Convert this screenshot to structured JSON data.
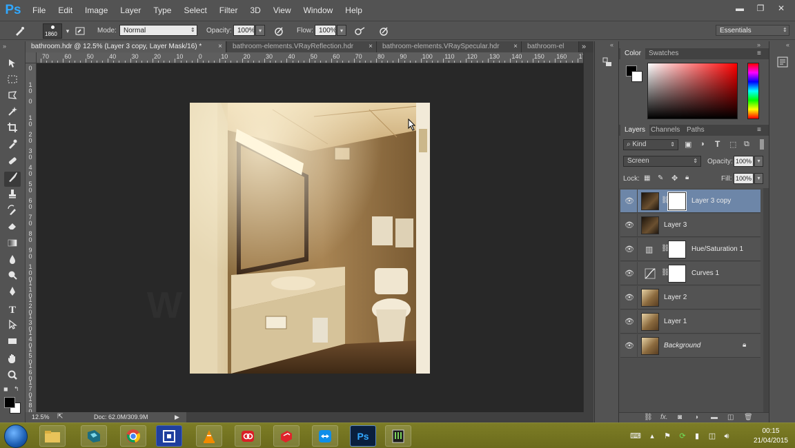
{
  "app": {
    "logo": "Ps"
  },
  "menu": [
    "File",
    "Edit",
    "Image",
    "Layer",
    "Type",
    "Select",
    "Filter",
    "3D",
    "View",
    "Window",
    "Help"
  ],
  "window_controls": {
    "minimize": "▬",
    "restore": "❐",
    "close": "✕"
  },
  "options": {
    "brush_size": "1860",
    "mode_label": "Mode:",
    "mode_value": "Normal",
    "opacity_label": "Opacity:",
    "opacity_value": "100%",
    "flow_label": "Flow:",
    "flow_value": "100%",
    "workspace": "Essentials"
  },
  "tabs": [
    {
      "label": "bathroom.hdr @ 12.5% (Layer 3 copy, Layer Mask/16) *",
      "active": true
    },
    {
      "label": "bathroom-elements.VRayReflection.hdr",
      "active": false
    },
    {
      "label": "bathroom-elements.VRaySpecular.hdr",
      "active": false
    },
    {
      "label": "bathroom-el",
      "active": false
    }
  ],
  "tab_close": "×",
  "tab_overflow": "»",
  "ruler_h": [
    "70",
    "60",
    "50",
    "40",
    "30",
    "20",
    "10",
    "0",
    "10",
    "20",
    "30",
    "40",
    "50",
    "60",
    "70",
    "80",
    "90",
    "100",
    "110",
    "120",
    "130",
    "140",
    "150",
    "160",
    "170"
  ],
  "ruler_v": [
    "0",
    "10",
    "0",
    "10",
    "20",
    "30",
    "40",
    "50",
    "60",
    "70",
    "80",
    "90",
    "100",
    "110",
    "120",
    "130",
    "140",
    "150",
    "160",
    "170",
    "180",
    "190"
  ],
  "status": {
    "zoom": "12.5%",
    "doc": "Doc: 62.0M/309.9M"
  },
  "color_panel": {
    "tabs": [
      "Color",
      "Swatches"
    ],
    "fg": "#000000",
    "bg": "#ffffff"
  },
  "layers_panel": {
    "tabs": [
      "Layers",
      "Channels",
      "Paths"
    ],
    "filter_kind": "Kind",
    "blend_mode": "Screen",
    "opacity_label": "Opacity:",
    "opacity_value": "100%",
    "lock_label": "Lock:",
    "fill_label": "Fill:",
    "fill_value": "100%",
    "layers": [
      {
        "name": "Layer 3 copy",
        "selected": true,
        "type": "dark-with-mask"
      },
      {
        "name": "Layer 3",
        "selected": false,
        "type": "dark"
      },
      {
        "name": "Hue/Saturation 1",
        "selected": false,
        "type": "adjust-hue"
      },
      {
        "name": "Curves 1",
        "selected": false,
        "type": "adjust-curves"
      },
      {
        "name": "Layer 2",
        "selected": false,
        "type": "photo"
      },
      {
        "name": "Layer 1",
        "selected": false,
        "type": "photo"
      },
      {
        "name": "Background",
        "selected": false,
        "type": "background",
        "italic": true
      }
    ],
    "footer_icons": [
      "link-icon",
      "fx-icon",
      "mask-icon",
      "adjustment-icon",
      "folder-icon",
      "new-layer-icon",
      "trash-icon"
    ],
    "fx_label": "fx."
  },
  "taskbar": {
    "apps": [
      "explorer",
      "3ds-max",
      "chrome",
      "app-blue",
      "vlc",
      "creative-cloud",
      "sketchup",
      "teamviewer",
      "photoshop",
      "renderer"
    ],
    "ps_label": "Ps",
    "time": "00:15",
    "date": "21/04/2015"
  }
}
